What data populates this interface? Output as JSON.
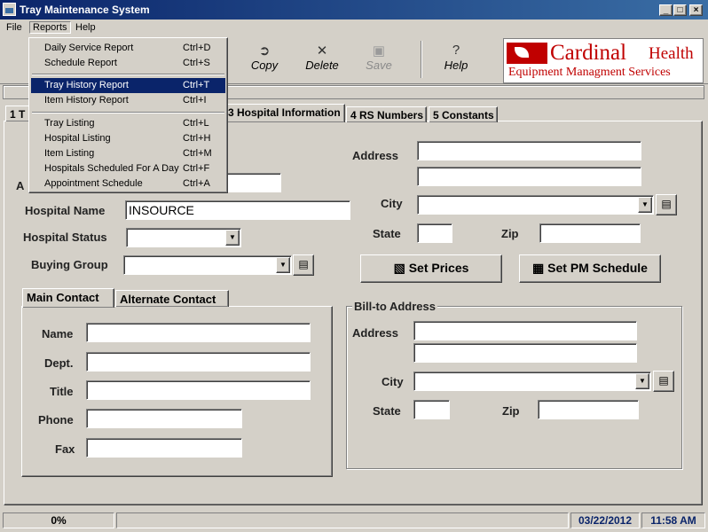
{
  "window": {
    "title": "Tray Maintenance System",
    "min": "_",
    "max": "□",
    "close": "×"
  },
  "menubar": {
    "file": "File",
    "reports": "Reports",
    "help": "Help"
  },
  "reports_menu": [
    {
      "label": "Daily Service Report",
      "shortcut": "Ctrl+D"
    },
    {
      "label": "Schedule Report",
      "shortcut": "Ctrl+S"
    },
    {
      "label": "Tray History Report",
      "shortcut": "Ctrl+T"
    },
    {
      "label": "Item History Report",
      "shortcut": "Ctrl+I"
    },
    {
      "label": "Tray Listing",
      "shortcut": "Ctrl+L"
    },
    {
      "label": "Hospital Listing",
      "shortcut": "Ctrl+H"
    },
    {
      "label": "Item Listing",
      "shortcut": "Ctrl+M"
    },
    {
      "label": "Hospitals Scheduled For A Day",
      "shortcut": "Ctrl+F"
    },
    {
      "label": "Appointment Schedule",
      "shortcut": "Ctrl+A"
    }
  ],
  "toolbar": {
    "copy": "Copy",
    "delete": "Delete",
    "save": "Save",
    "help": "Help"
  },
  "logo": {
    "brand_a": "Cardinal",
    "brand_b": "Health",
    "tagline": "Equipment Managment Services"
  },
  "tabs": {
    "t1_num": "1",
    "t1_label": "T",
    "t3": "3 Hospital Information",
    "t4": "4 RS Numbers",
    "t5": "5 Constants"
  },
  "form": {
    "a_label_partial": "A",
    "hospital_name_label": "Hospital Name",
    "hospital_name_value": "INSOURCE",
    "hospital_status_label": "Hospital Status",
    "buying_group_label": "Buying Group",
    "address_label": "Address",
    "city_label": "City",
    "state_label": "State",
    "zip_label": "Zip",
    "set_prices": "Set Prices",
    "set_pm_schedule": "Set PM Schedule"
  },
  "contact_tabs": {
    "main": "Main Contact",
    "alternate": "Alternate Contact"
  },
  "contact": {
    "name": "Name",
    "dept": "Dept.",
    "title": "Title",
    "phone": "Phone",
    "fax": "Fax"
  },
  "billto": {
    "group": "Bill-to Address",
    "address": "Address",
    "city": "City",
    "state": "State",
    "zip": "Zip"
  },
  "status": {
    "progress": "0%",
    "date": "03/22/2012",
    "time": "11:58 AM"
  },
  "colors": {
    "title_start": "#0a246a",
    "title_end": "#3a6ea5",
    "status_blue": "#0a246a",
    "logo_red": "#c00000"
  }
}
